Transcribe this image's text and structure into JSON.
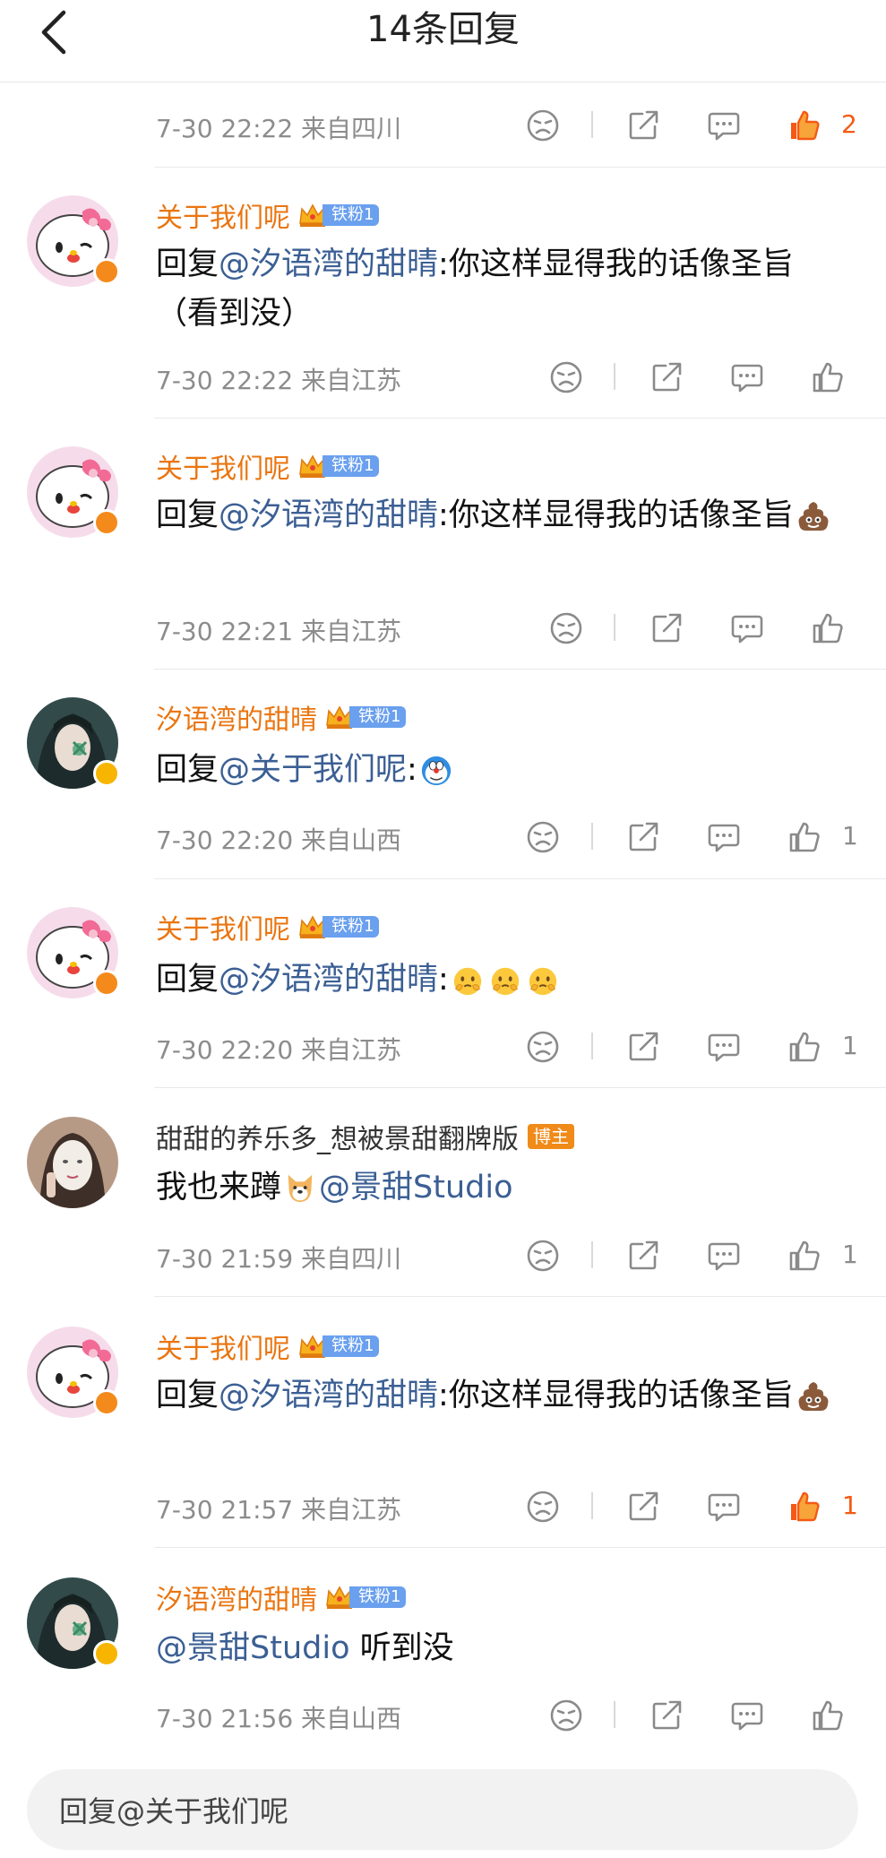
{
  "header": {
    "title": "14条回复"
  },
  "top_meta": {
    "time": "7-30 22:22 来自四川",
    "likes": "2"
  },
  "comments": [
    {
      "user": "关于我们呢",
      "badge": "铁粉1",
      "reply_prefix": "回复",
      "mention": "@汐语湾的甜晴",
      "body": ":你这样显得我的话像圣旨（看到没）",
      "time": "7-30 22:22 来自江苏",
      "likes": ""
    },
    {
      "user": "关于我们呢",
      "badge": "铁粉1",
      "reply_prefix": "回复",
      "mention": "@汐语湾的甜晴",
      "body": ":你这样显得我的话像圣旨",
      "time": "7-30 22:21 来自江苏",
      "likes": ""
    },
    {
      "user": "汐语湾的甜晴",
      "badge": "铁粉1",
      "reply_prefix": "回复",
      "mention": "@关于我们呢",
      "body": ":",
      "time": "7-30 22:20 来自山西",
      "likes": "1"
    },
    {
      "user": "关于我们呢",
      "badge": "铁粉1",
      "reply_prefix": "回复",
      "mention": "@汐语湾的甜晴",
      "body": ":",
      "time": "7-30 22:20 来自江苏",
      "likes": "1"
    },
    {
      "user": "甜甜的养乐多_想被景甜翻牌版",
      "badge": "博主",
      "reply_prefix": "我也来蹲",
      "mention": "@景甜Studio",
      "body": "",
      "time": "7-30 21:59 来自四川",
      "likes": "1"
    },
    {
      "user": "关于我们呢",
      "badge": "铁粉1",
      "reply_prefix": "回复",
      "mention": "@汐语湾的甜晴",
      "body": ":你这样显得我的话像圣旨",
      "time": "7-30 21:57 来自江苏",
      "likes": "1"
    },
    {
      "user": "汐语湾的甜晴",
      "badge": "铁粉1",
      "reply_prefix": "",
      "mention": "@景甜Studio",
      "body": " 听到没",
      "time": "7-30 21:56 来自山西",
      "likes": ""
    }
  ],
  "reply_bar": {
    "placeholder": "回复@关于我们呢"
  },
  "colors": {
    "username": "#ea7510",
    "mention": "#3b5f94",
    "like_active": "#f45a14",
    "meta": "#8c8c8c",
    "fan_badge": "#6aa0ee",
    "blogger_badge": "#f08a18"
  },
  "icons": [
    "back-arrow-icon",
    "dislike-face-icon",
    "share-icon",
    "comment-icon",
    "thumbs-up-icon",
    "crown-icon",
    "verified-badge-icon",
    "poop-emoji-icon",
    "doraemon-emoji-icon",
    "blush-emoji-icon",
    "dog-emoji-icon"
  ]
}
